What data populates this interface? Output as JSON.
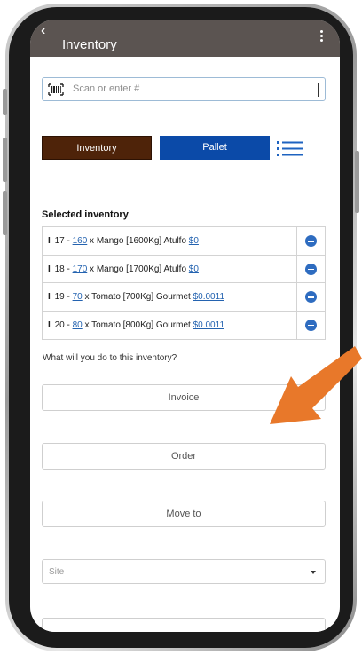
{
  "header": {
    "title": "Inventory",
    "back_glyph": "‹"
  },
  "search": {
    "placeholder": "Scan or enter #",
    "icon": "barcode-icon"
  },
  "toggle": {
    "inventory_label": "Inventory",
    "pallet_label": "Pallet"
  },
  "colors": {
    "appbar": "#5b5451",
    "inventory_btn": "#4e2309",
    "pallet_btn": "#0b4aa8",
    "link": "#2463b0",
    "arrow": "#e8782a"
  },
  "selected": {
    "title": "Selected inventory",
    "items": [
      {
        "marker": "I",
        "id": "17",
        "qty": "160",
        "desc": "x Mango [1600Kg] Atulfo",
        "price": "$0"
      },
      {
        "marker": "I",
        "id": "18",
        "qty": "170",
        "desc": "x Mango [1700Kg] Atulfo",
        "price": "$0"
      },
      {
        "marker": "I",
        "id": "19",
        "qty": "70",
        "desc": "x Tomato [700Kg] Gourmet",
        "price": "$0.0011"
      },
      {
        "marker": "I",
        "id": "20",
        "qty": "80",
        "desc": "x Tomato [800Kg] Gourmet",
        "price": "$0.0011"
      }
    ]
  },
  "question": "What will you do to this inventory?",
  "actions": {
    "invoice": "Invoice",
    "order": "Order",
    "move": "Move to"
  },
  "site": {
    "placeholder": "Site"
  }
}
